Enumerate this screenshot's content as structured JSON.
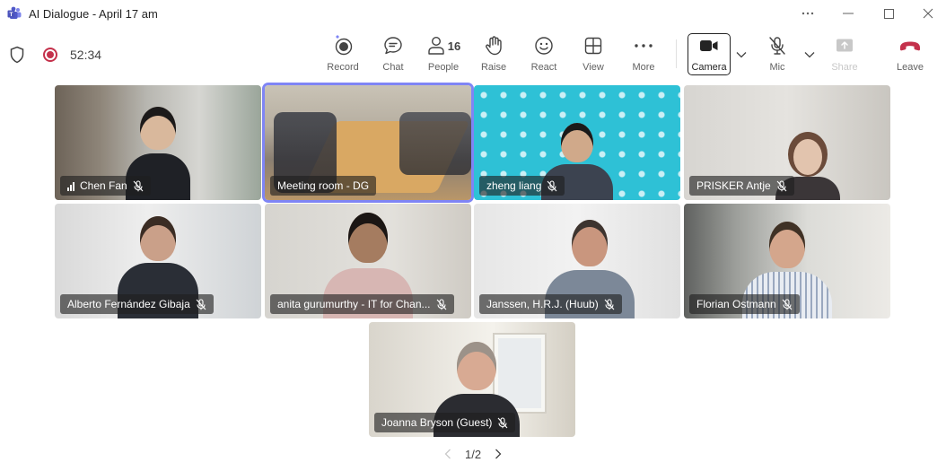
{
  "window": {
    "title": "AI Dialogue - April 17 am"
  },
  "status": {
    "timer": "52:34"
  },
  "toolbar": {
    "record": "Record",
    "chat": "Chat",
    "people": "People",
    "people_count": "16",
    "raise": "Raise",
    "react": "React",
    "view": "View",
    "more": "More",
    "camera": "Camera",
    "mic": "Mic",
    "share": "Share",
    "leave": "Leave"
  },
  "participants": [
    {
      "name": "Chen Fan",
      "muted": true,
      "signal": true
    },
    {
      "name": "Meeting room - DG",
      "muted": false,
      "active_speaker": true
    },
    {
      "name": "zheng liang",
      "muted": true
    },
    {
      "name": "PRISKER Antje",
      "muted": true
    },
    {
      "name": "Alberto Fernández Gibaja",
      "muted": true
    },
    {
      "name": "anita gurumurthy - IT for Chan...",
      "muted": true
    },
    {
      "name": "Janssen, H.R.J. (Huub)",
      "muted": true
    },
    {
      "name": "Florian Ostmann",
      "muted": true
    },
    {
      "name": "Joanna Bryson (Guest)",
      "muted": true
    }
  ],
  "pagination": {
    "label": "1/2"
  },
  "colors": {
    "accent": "#7f85f5",
    "leave": "#c4314b",
    "recording": "#c4314b"
  }
}
